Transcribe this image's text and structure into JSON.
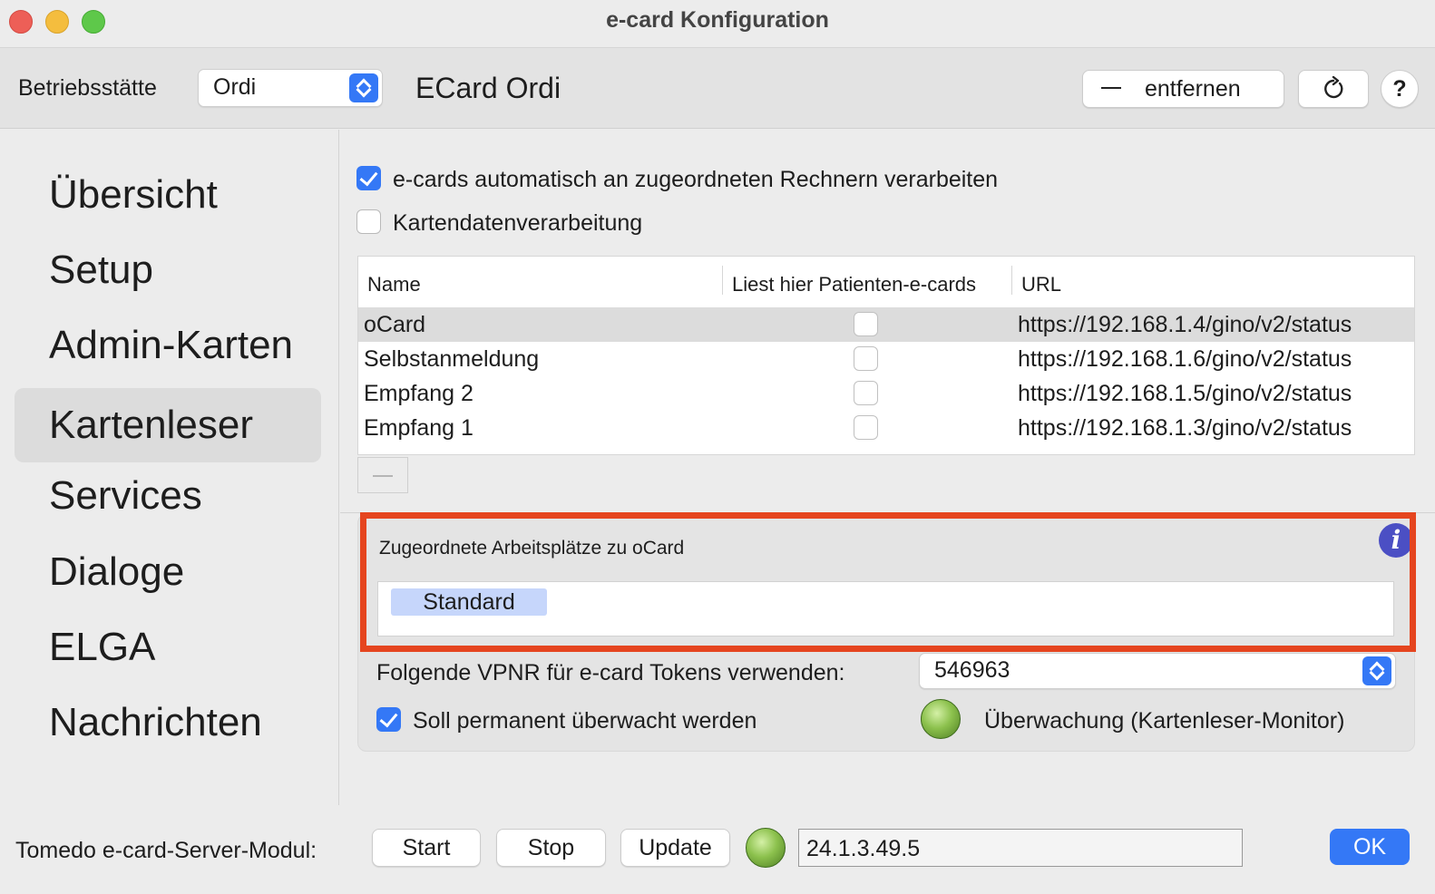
{
  "window": {
    "title": "e-card Konfiguration"
  },
  "toolbar": {
    "location_label": "Betriebsstätte",
    "location_value": "Ordi",
    "center_title": "ECard Ordi",
    "remove_label": "entfernen",
    "refresh_icon": "refresh-icon",
    "help_label": "?"
  },
  "sidebar": {
    "items": [
      {
        "label": "Übersicht"
      },
      {
        "label": "Setup"
      },
      {
        "label": "Admin-Karten"
      },
      {
        "label": "Kartenleser",
        "active": true
      },
      {
        "label": "Services"
      },
      {
        "label": "Dialoge"
      },
      {
        "label": "ELGA"
      },
      {
        "label": "Nachrichten"
      }
    ]
  },
  "options": {
    "auto_process_label": "e-cards automatisch an zugeordneten Rechnern verarbeiten",
    "auto_process_checked": true,
    "card_data_label": "Kartendatenverarbeitung",
    "card_data_checked": false
  },
  "table": {
    "columns": [
      "Name",
      "Liest hier Patienten-e-cards",
      "URL"
    ],
    "rows": [
      {
        "name": "oCard",
        "reads_patient_cards": false,
        "url": "https://192.168.1.4/gino/v2/status",
        "selected": true
      },
      {
        "name": "Selbstanmeldung",
        "reads_patient_cards": false,
        "url": "https://192.168.1.6/gino/v2/status"
      },
      {
        "name": "Empfang 2",
        "reads_patient_cards": false,
        "url": "https://192.168.1.5/gino/v2/status"
      },
      {
        "name": "Empfang 1",
        "reads_patient_cards": false,
        "url": "https://192.168.1.3/gino/v2/status"
      }
    ]
  },
  "assigned": {
    "title": "Zugeordnete Arbeitsplätze zu oCard",
    "info_icon": "i",
    "workstations": [
      "Standard"
    ]
  },
  "vpnr": {
    "label": "Folgende VPNR für e-card Tokens verwenden:",
    "value": "546963"
  },
  "monitoring": {
    "permanent_label": "Soll permanent überwacht werden",
    "permanent_checked": true,
    "monitor_label": "Überwachung (Kartenleser-Monitor)"
  },
  "footer": {
    "module_label": "Tomedo e-card-Server-Modul:",
    "start_label": "Start",
    "stop_label": "Stop",
    "update_label": "Update",
    "version": "24.1.3.49.5",
    "ok_label": "OK"
  },
  "colors": {
    "accent": "#3478f6",
    "highlight_border": "#e5451f",
    "token_bg": "#c6d6fb",
    "status_led": "#8cc14d"
  }
}
